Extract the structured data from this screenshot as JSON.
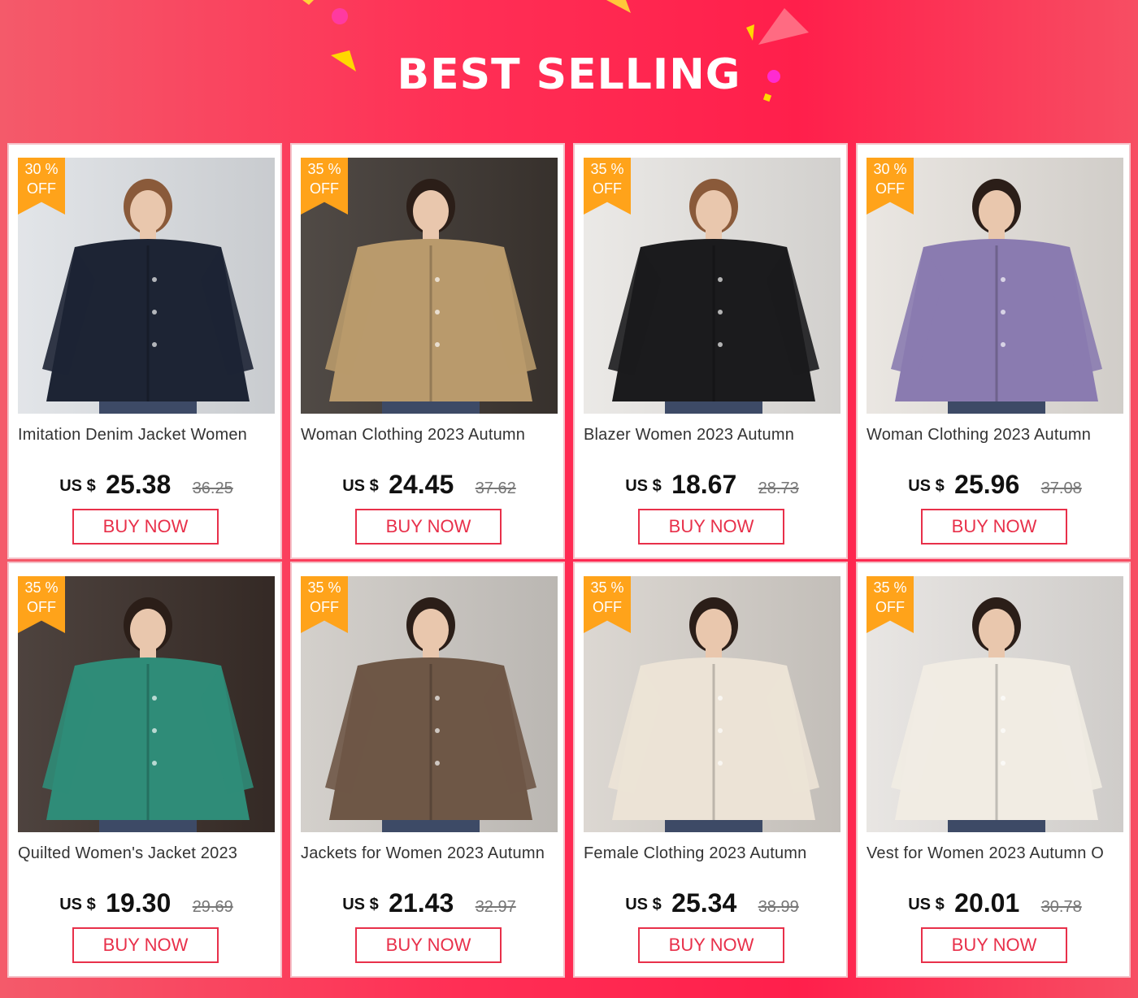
{
  "banner": {
    "title": "BEST SELLING",
    "colors": {
      "start": "#f45a6a",
      "mid": "#ff2f55",
      "end": "#f74e63",
      "accent": "#e8304a",
      "badge": "#ffa31a"
    }
  },
  "products": [
    {
      "discount": "30 %",
      "off": "OFF",
      "name": "Imitation Denim Jacket Women",
      "currency": "US $",
      "price": "25.38",
      "old_price": "36.25",
      "button": "BUY NOW",
      "photo": "navy-denim-jacket",
      "garment_color": "#1d2434",
      "bg_color": "#dfe2e6"
    },
    {
      "discount": "35 %",
      "off": "OFF",
      "name": "Woman Clothing 2023 Autumn",
      "currency": "US $",
      "price": "24.45",
      "old_price": "37.62",
      "button": "BUY NOW",
      "photo": "khaki-quilted-jacket",
      "garment_color": "#b99a6c",
      "bg_color": "#3d3631"
    },
    {
      "discount": "35 %",
      "off": "OFF",
      "name": "Blazer Women 2023 Autumn",
      "currency": "US $",
      "price": "18.67",
      "old_price": "28.73",
      "button": "BUY NOW",
      "photo": "black-blazer",
      "garment_color": "#1b1b1d",
      "bg_color": "#e9e7e4"
    },
    {
      "discount": "30 %",
      "off": "OFF",
      "name": "Woman Clothing 2023 Autumn",
      "currency": "US $",
      "price": "25.96",
      "old_price": "37.08",
      "button": "BUY NOW",
      "photo": "purple-fleece-jacket",
      "garment_color": "#8a7bb0",
      "bg_color": "#e8e4df"
    },
    {
      "discount": "35 %",
      "off": "OFF",
      "name": "Quilted Women's Jacket 2023",
      "currency": "US $",
      "price": "19.30",
      "old_price": "29.69",
      "button": "BUY NOW",
      "photo": "green-quilted-jacket",
      "garment_color": "#2f8c78",
      "bg_color": "#3a2e29"
    },
    {
      "discount": "35 %",
      "off": "OFF",
      "name": "Jackets for Women 2023 Autumn",
      "currency": "US $",
      "price": "21.43",
      "old_price": "32.97",
      "button": "BUY NOW",
      "photo": "brown-teddy-coat",
      "garment_color": "#6e5746",
      "bg_color": "#cfcbc6"
    },
    {
      "discount": "35 %",
      "off": "OFF",
      "name": "Female Clothing 2023 Autumn",
      "currency": "US $",
      "price": "25.34",
      "old_price": "38.99",
      "button": "BUY NOW",
      "photo": "cream-black-fleece-jacket",
      "garment_color": "#ece3d6",
      "bg_color": "#d8d3cd"
    },
    {
      "discount": "35 %",
      "off": "OFF",
      "name": "Vest for Women 2023 Autumn O",
      "currency": "US $",
      "price": "20.01",
      "old_price": "30.78",
      "button": "BUY NOW",
      "photo": "white-sherpa-vest",
      "garment_color": "#f1ece3",
      "bg_color": "#e6e3e0"
    }
  ]
}
